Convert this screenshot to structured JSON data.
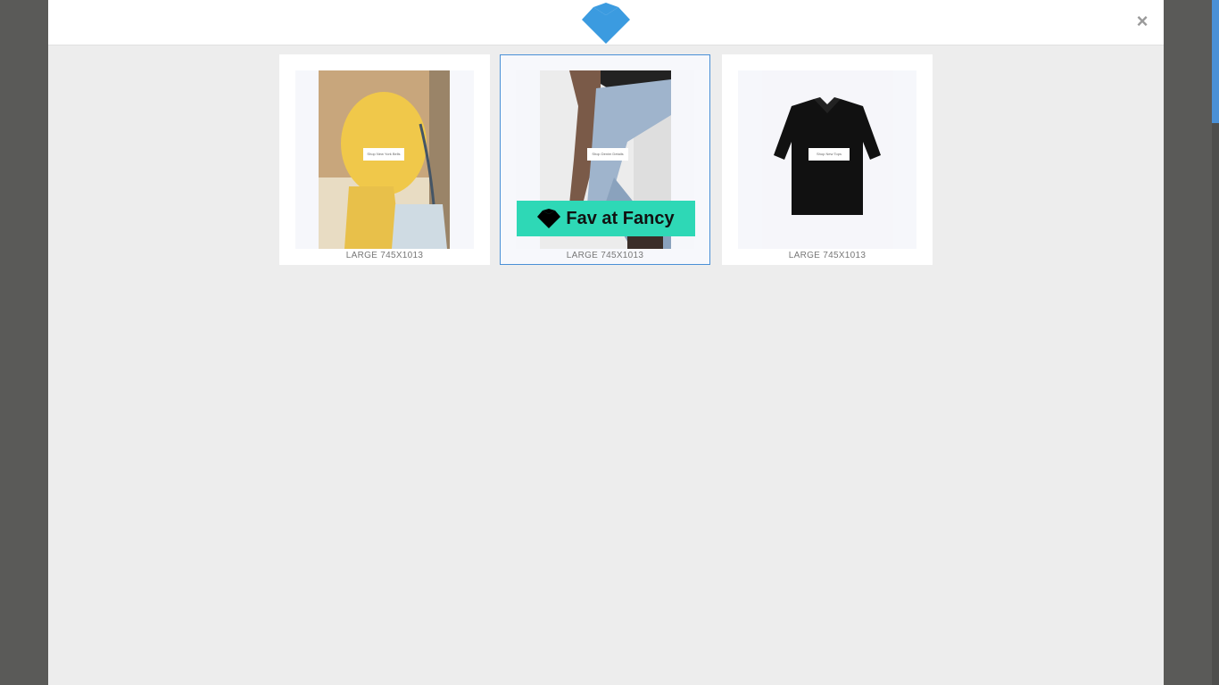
{
  "modal": {
    "close_label": "×",
    "logo_icon": "heart-logo-icon",
    "accent": "#3b9be0"
  },
  "images": [
    {
      "tag": "Shop New York Bells",
      "caption": "LARGE 745X1013",
      "selected": false
    },
    {
      "tag": "Shop Denim Details",
      "caption": "LARGE 745X1013",
      "selected": true
    },
    {
      "tag": "Shop New Tops",
      "caption": "LARGE 745X1013",
      "selected": false
    }
  ],
  "fav_button": {
    "label": "Fav at Fancy",
    "bg": "#2ed8b6"
  }
}
